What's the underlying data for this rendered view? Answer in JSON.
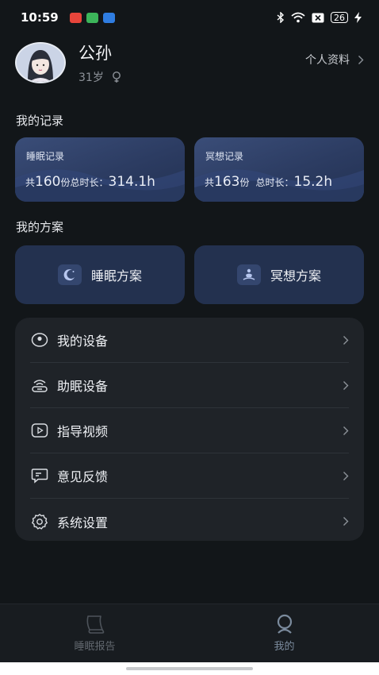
{
  "status_bar": {
    "time": "10:59",
    "battery": "26",
    "app_colors": [
      "#e7453b",
      "#3cb55a",
      "#2f7de1"
    ]
  },
  "profile": {
    "name": "公孙",
    "age": "31岁",
    "gender_icon": "female-icon",
    "link_label": "个人资料"
  },
  "records": {
    "section_title": "我的记录",
    "sleep": {
      "title": "睡眠记录",
      "prefix": "共",
      "count": "160",
      "unit": "份",
      "duration_label": "总时长：",
      "duration": "314.1h"
    },
    "meditation": {
      "title": "冥想记录",
      "prefix": "共",
      "count": "163",
      "unit": "份",
      "duration_label": "总时长：",
      "duration": "15.2h"
    }
  },
  "plans": {
    "section_title": "我的方案",
    "sleep_plan": "睡眠方案",
    "meditation_plan": "冥想方案"
  },
  "menu": [
    {
      "label": "我的设备",
      "icon": "device-icon"
    },
    {
      "label": "助眠设备",
      "icon": "sleep-device-icon"
    },
    {
      "label": "指导视频",
      "icon": "video-icon"
    },
    {
      "label": "意见反馈",
      "icon": "feedback-icon"
    },
    {
      "label": "系统设置",
      "icon": "gear-icon"
    }
  ],
  "tabbar": {
    "report": "睡眠报告",
    "mine": "我的"
  },
  "colors": {
    "background": "#121619",
    "card": "#23314f",
    "menu_bg": "#1f2328"
  }
}
